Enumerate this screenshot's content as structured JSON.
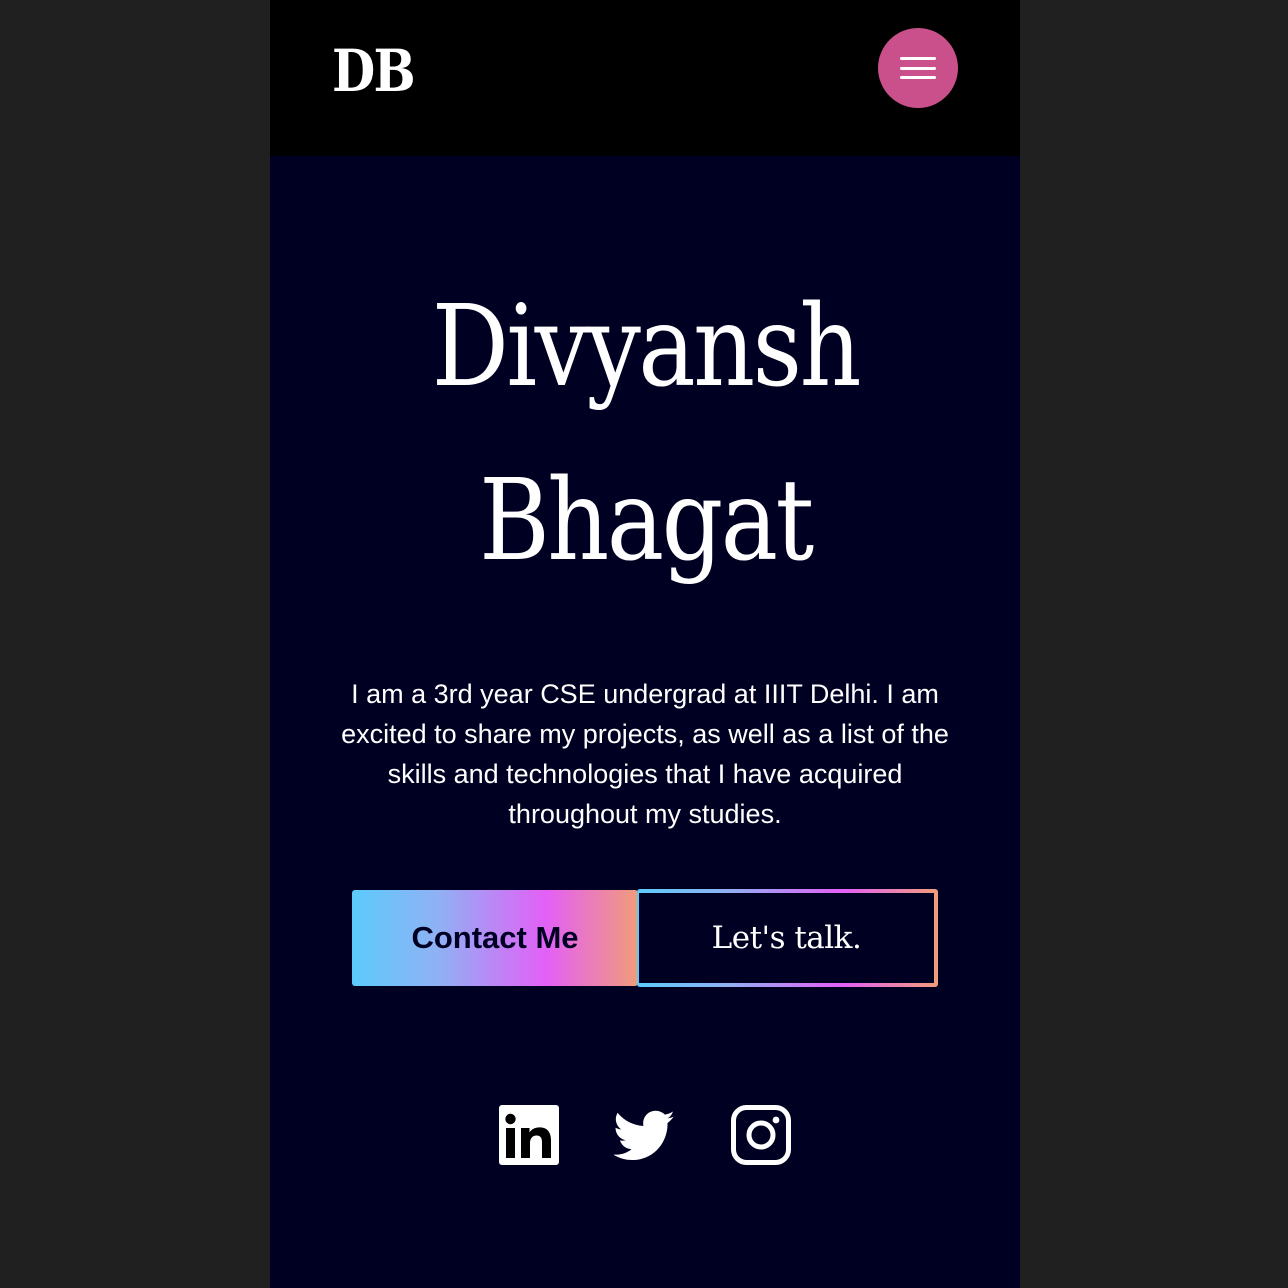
{
  "header": {
    "logo": "DB",
    "menu_icon": "hamburger-menu-icon",
    "menu_button_color": "#c9508a"
  },
  "hero": {
    "first_name": "Divyansh",
    "last_name": "Bhagat",
    "intro": "I am a 3rd year CSE undergrad at IIIT Delhi. I am excited to share my projects, as well as a list of the skills and technologies that I have acquired throughout my studies."
  },
  "actions": {
    "contact_label": "Contact Me",
    "talk_label": "Let's talk."
  },
  "socials": [
    {
      "name": "LinkedIn",
      "icon": "linkedin-icon"
    },
    {
      "name": "Twitter",
      "icon": "twitter-icon"
    },
    {
      "name": "Instagram",
      "icon": "instagram-icon"
    }
  ],
  "colors": {
    "page_background": "#000022",
    "navbar_background": "#000000",
    "gradient": [
      "#5ccbfc",
      "#8fb1f4",
      "#e360f6",
      "#f19c7a"
    ]
  }
}
